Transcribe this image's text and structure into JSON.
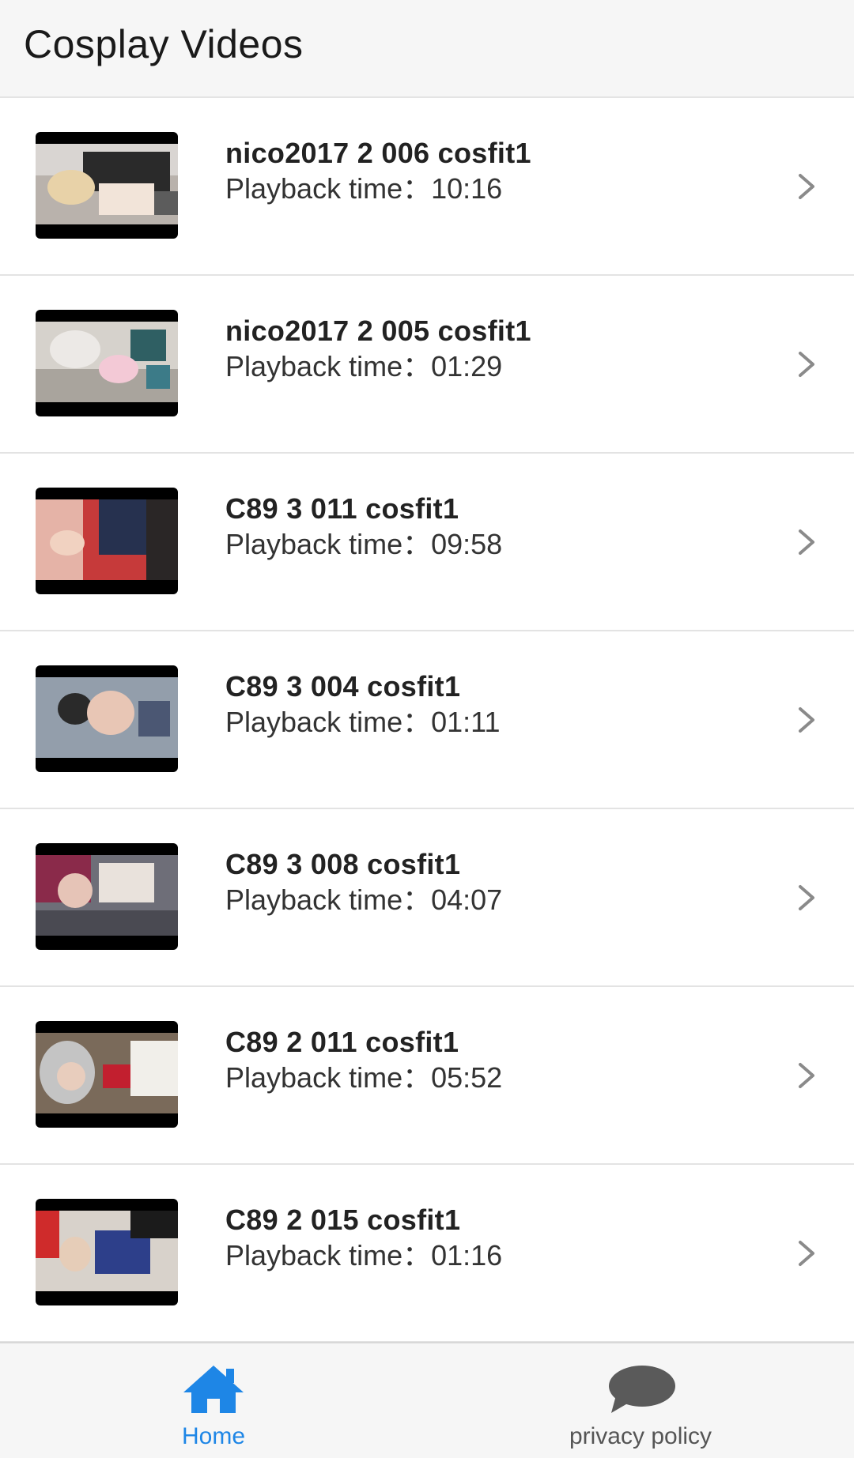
{
  "header": {
    "title": "Cosplay Videos"
  },
  "colors": {
    "accent": "#1e86e6",
    "inactive_tab": "#5a5a5a",
    "chevron": "#8a8a8a"
  },
  "videos": [
    {
      "title": "nico2017 2 006 cosfit1",
      "playback": "Playback time：10:16"
    },
    {
      "title": "nico2017 2 005 cosfit1",
      "playback": "Playback time：01:29"
    },
    {
      "title": "C89 3 011 cosfit1",
      "playback": "Playback time：09:58"
    },
    {
      "title": "C89 3 004 cosfit1",
      "playback": "Playback time：01:11"
    },
    {
      "title": "C89 3 008 cosfit1",
      "playback": "Playback time：04:07"
    },
    {
      "title": "C89 2 011 cosfit1",
      "playback": "Playback time：05:52"
    },
    {
      "title": "C89 2 015 cosfit1",
      "playback": "Playback time：01:16"
    }
  ],
  "tabbar": {
    "home_label": "Home",
    "home_icon": "home-icon",
    "privacy_label": "privacy policy",
    "privacy_icon": "speech-bubble-icon"
  }
}
